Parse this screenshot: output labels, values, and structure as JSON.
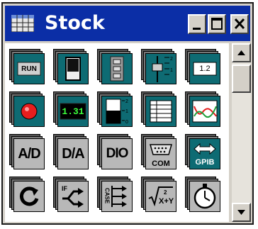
{
  "window": {
    "title": "Stock",
    "title_bar_color": "#0b2ea6",
    "controls": [
      "minimize-icon",
      "maximize-icon",
      "close-icon"
    ]
  },
  "palette": {
    "rows": [
      [
        {
          "name": "run-button-control",
          "label": "RUN",
          "style": "teal"
        },
        {
          "name": "toggle-switch-control",
          "label": "",
          "style": "teal"
        },
        {
          "name": "led-stack-control",
          "label": "",
          "style": "teal"
        },
        {
          "name": "slider-control",
          "label": "",
          "style": "teal"
        },
        {
          "name": "numeric-input-control",
          "label": "1.2",
          "style": "teal"
        }
      ],
      [
        {
          "name": "led-indicator",
          "label": "",
          "style": "teal"
        },
        {
          "name": "digital-display",
          "label": "1.31",
          "style": "teal"
        },
        {
          "name": "meter-bar",
          "label": "",
          "style": "teal"
        },
        {
          "name": "table-grid",
          "label": "",
          "style": "teal"
        },
        {
          "name": "waveform-graph",
          "label": "",
          "style": "teal"
        }
      ],
      [
        {
          "name": "ad-converter",
          "label": "A/D",
          "style": "grey"
        },
        {
          "name": "da-converter",
          "label": "D/A",
          "style": "grey"
        },
        {
          "name": "digital-io",
          "label": "DIO",
          "style": "grey"
        },
        {
          "name": "com-port",
          "label": "COM",
          "style": "grey"
        },
        {
          "name": "gpib-bus",
          "label": "GPIB",
          "style": "teal"
        }
      ],
      [
        {
          "name": "loop-block",
          "label": "",
          "style": "grey"
        },
        {
          "name": "if-branch",
          "label": "IF",
          "style": "grey"
        },
        {
          "name": "case-block",
          "label": "CASE",
          "style": "grey"
        },
        {
          "name": "formula-block",
          "label": "",
          "style": "grey"
        },
        {
          "name": "timer-block",
          "label": "",
          "style": "grey"
        }
      ]
    ],
    "display_values": {
      "numeric": "1.2",
      "digital": "1.31"
    }
  },
  "scrollbar": {
    "up": "arrow-up-icon",
    "down": "arrow-down-icon"
  }
}
